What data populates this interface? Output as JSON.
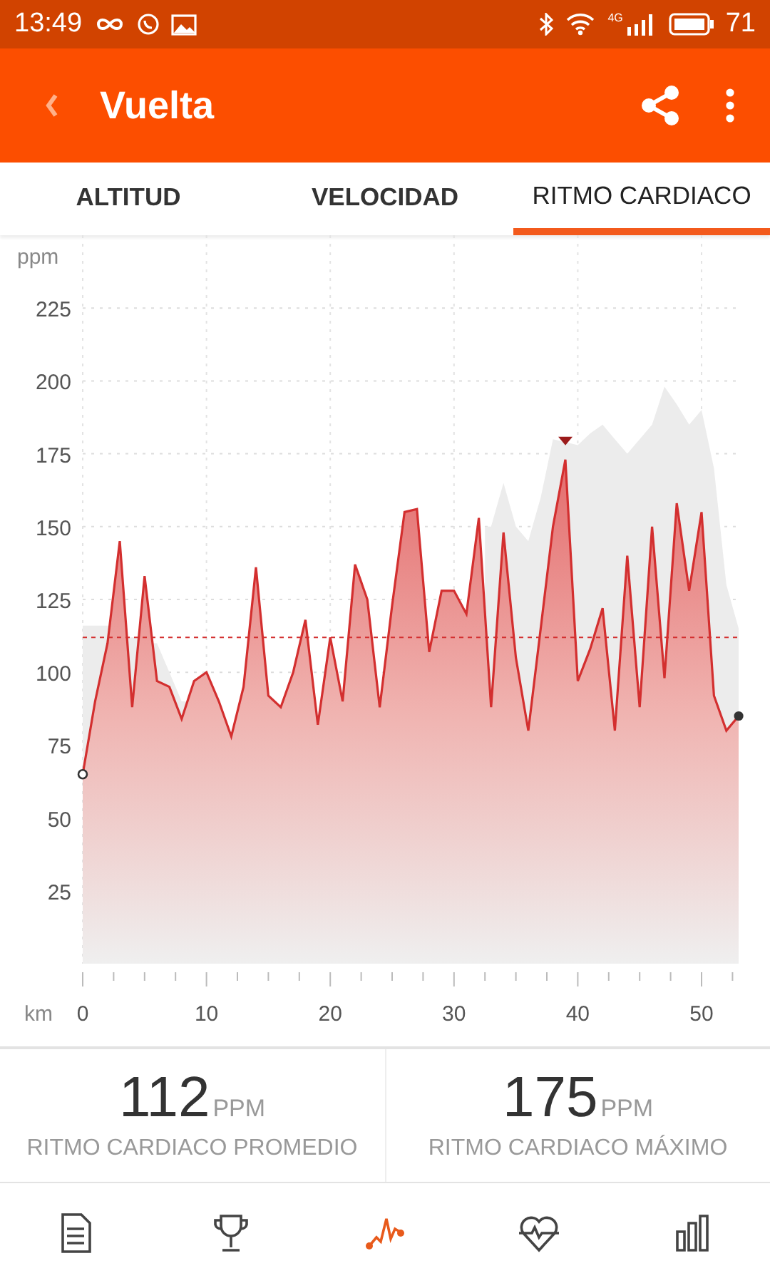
{
  "status_bar": {
    "time": "13:49",
    "network": "4G",
    "battery": "71"
  },
  "app_bar": {
    "title": "Vuelta"
  },
  "tabs": [
    {
      "label": "ALTITUD",
      "selected": false
    },
    {
      "label": "VELOCIDAD",
      "selected": false
    },
    {
      "label": "RITMO CARDIACO",
      "selected": true
    }
  ],
  "chart": {
    "chart_data": {
      "type": "area",
      "xlabel": "km",
      "ylabel": "ppm",
      "x": [
        0,
        1,
        2,
        3,
        4,
        5,
        6,
        7,
        8,
        9,
        10,
        11,
        12,
        13,
        14,
        15,
        16,
        17,
        18,
        19,
        20,
        21,
        22,
        23,
        24,
        25,
        26,
        27,
        28,
        29,
        30,
        31,
        32,
        33,
        34,
        35,
        36,
        37,
        38,
        39,
        40,
        41,
        42,
        43,
        44,
        45,
        46,
        47,
        48,
        49,
        50,
        51,
        52,
        53
      ],
      "series": [
        {
          "color": "#d32f2f",
          "values": [
            65,
            90,
            110,
            145,
            88,
            133,
            97,
            95,
            84,
            97,
            100,
            90,
            78,
            95,
            136,
            92,
            88,
            100,
            118,
            82,
            112,
            90,
            137,
            125,
            88,
            123,
            155,
            156,
            107,
            128,
            128,
            120,
            153,
            88,
            148,
            105,
            80,
            115,
            150,
            173,
            97,
            108,
            122,
            80,
            140,
            88,
            150,
            98,
            158,
            128,
            155,
            92,
            80,
            85
          ]
        },
        {
          "color": "#ececec",
          "values": [
            116,
            116,
            116,
            null,
            112,
            null,
            110,
            100,
            90,
            null,
            null,
            null,
            null,
            null,
            null,
            null,
            null,
            null,
            null,
            null,
            null,
            null,
            null,
            null,
            null,
            null,
            null,
            null,
            null,
            null,
            null,
            null,
            null,
            150,
            165,
            150,
            145,
            160,
            180,
            179,
            178,
            182,
            185,
            180,
            175,
            180,
            185,
            198,
            192,
            185,
            190,
            170,
            130,
            115
          ]
        }
      ],
      "xlim": [
        0,
        53
      ],
      "ylim": [
        0,
        250
      ],
      "xticks": [
        0,
        10,
        20,
        30,
        40,
        50
      ],
      "yticks": [
        25,
        50,
        75,
        100,
        125,
        150,
        175,
        200,
        225
      ],
      "grid": true,
      "ref_lines": [
        {
          "axis": "y",
          "value": 112
        }
      ]
    }
  },
  "stats": [
    {
      "value": "112",
      "unit": "PPM",
      "label": "RITMO CARDIACO PROMEDIO"
    },
    {
      "value": "175",
      "unit": "PPM",
      "label": "RITMO CARDIACO MÁXIMO"
    }
  ],
  "bottom_nav": [
    {
      "kind": "summary",
      "selected": false
    },
    {
      "kind": "trophy",
      "selected": false
    },
    {
      "kind": "chart",
      "selected": true
    },
    {
      "kind": "heart",
      "selected": false
    },
    {
      "kind": "bars",
      "selected": false
    }
  ]
}
